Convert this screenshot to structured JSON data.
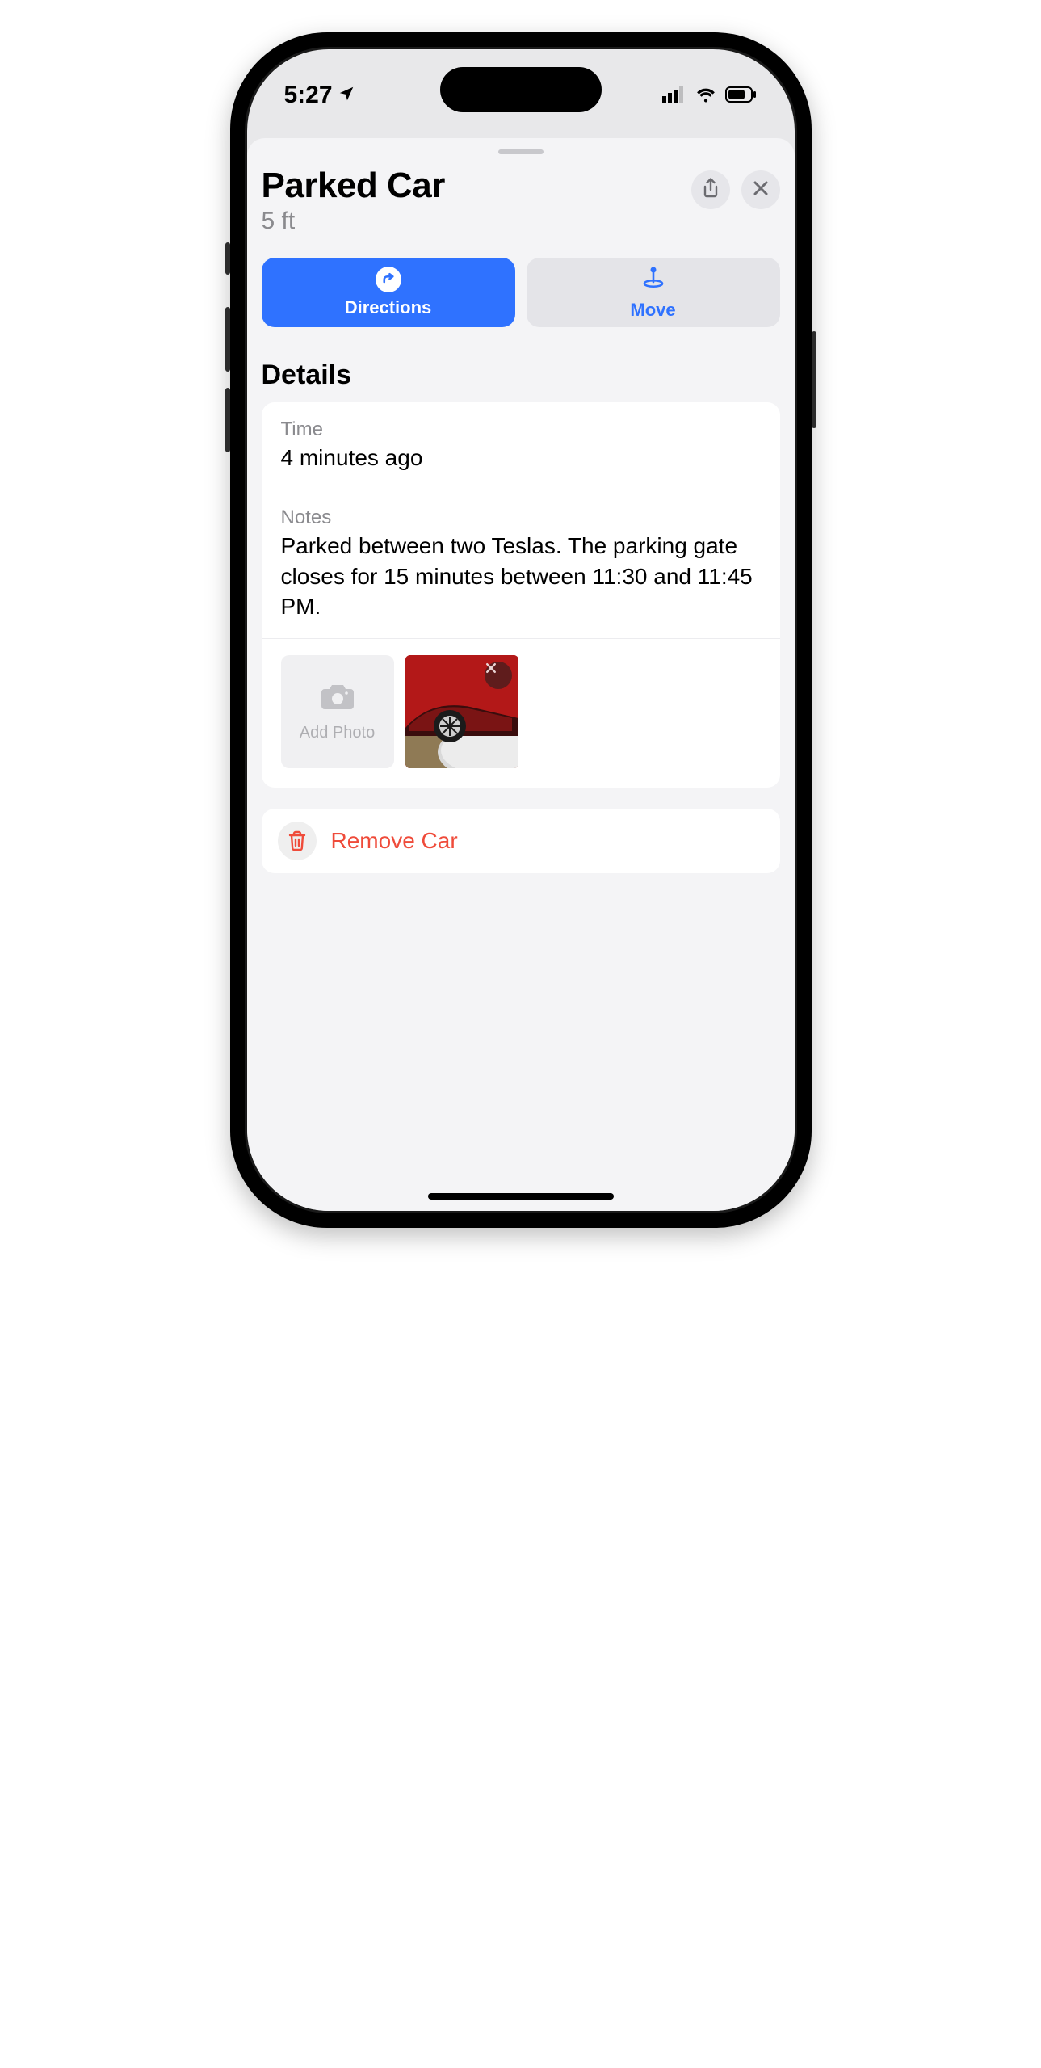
{
  "status": {
    "time": "5:27"
  },
  "header": {
    "title": "Parked Car",
    "subtitle": "5 ft"
  },
  "actions": {
    "directions_label": "Directions",
    "move_label": "Move"
  },
  "details": {
    "section_title": "Details",
    "time_label": "Time",
    "time_value": "4 minutes ago",
    "notes_label": "Notes",
    "notes_value": "Parked between two Teslas. The parking gate closes for 15 minutes between 11:30 and 11:45 PM.",
    "add_photo_label": "Add Photo"
  },
  "remove": {
    "label": "Remove Car"
  }
}
